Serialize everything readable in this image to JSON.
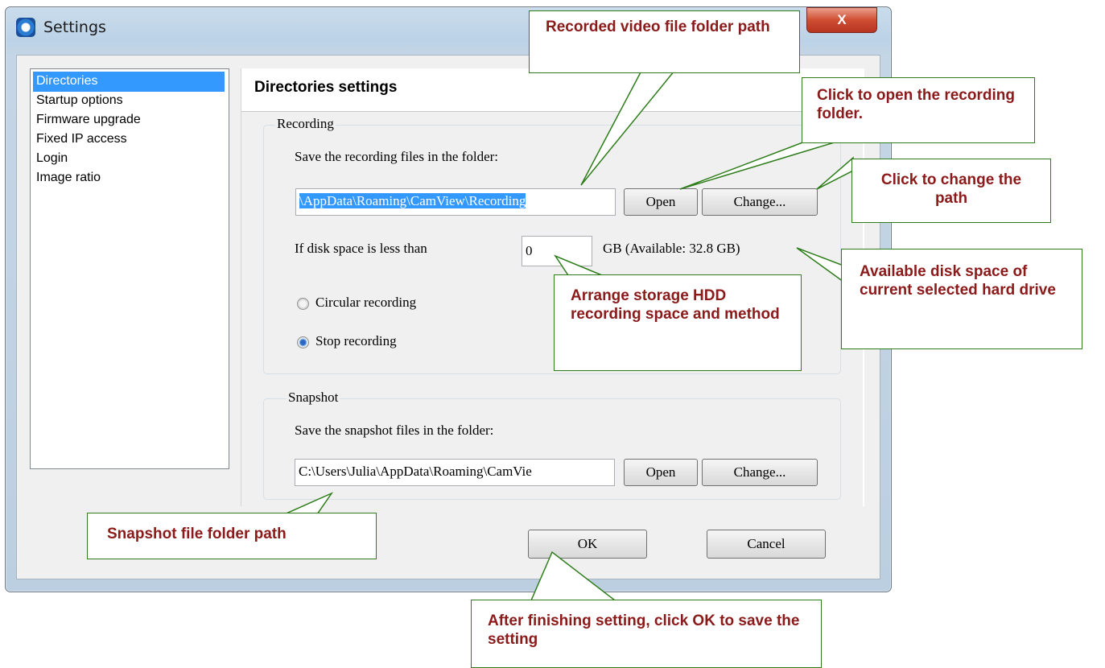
{
  "window": {
    "title": "Settings",
    "close_glyph": "X"
  },
  "nav": {
    "items": [
      "Directories",
      "Startup options",
      "Firmware upgrade",
      "Fixed IP access",
      "Login",
      "Image ratio"
    ],
    "selected": 0
  },
  "panel": {
    "title": "Directories settings",
    "recording": {
      "group_label": "Recording",
      "save_label": "Save the recording files in the folder:",
      "path_value": "\\AppData\\Roaming\\CamView\\Recording",
      "open_label": "Open",
      "change_label": "Change...",
      "disk_label": "If disk space is less than",
      "disk_value": "0",
      "available_label": "GB (Available: 32.8 GB)",
      "circular_label": "Circular recording",
      "stop_label": "Stop recording"
    },
    "snapshot": {
      "group_label": "Snapshot",
      "save_label": "Save the snapshot files in the folder:",
      "path_value": "C:\\Users\\Julia\\AppData\\Roaming\\CamVie",
      "open_label": "Open",
      "change_label": "Change..."
    }
  },
  "footer": {
    "ok_label": "OK",
    "cancel_label": "Cancel"
  },
  "callouts": {
    "recorded_path": "Recorded video file folder path",
    "open_folder": "Click to open the recording folder.",
    "change_path": "Click to change the path",
    "available_space": "Available disk space of current selected hard drive",
    "arrange_storage": "Arrange storage HDD recording space and method",
    "snapshot_path": "Snapshot file folder path",
    "ok_note": "After finishing setting, click OK to save the setting"
  },
  "colors": {
    "callout_text": "#8b1a1a",
    "callout_border": "#2e7d1a",
    "selection": "#3399ff"
  }
}
